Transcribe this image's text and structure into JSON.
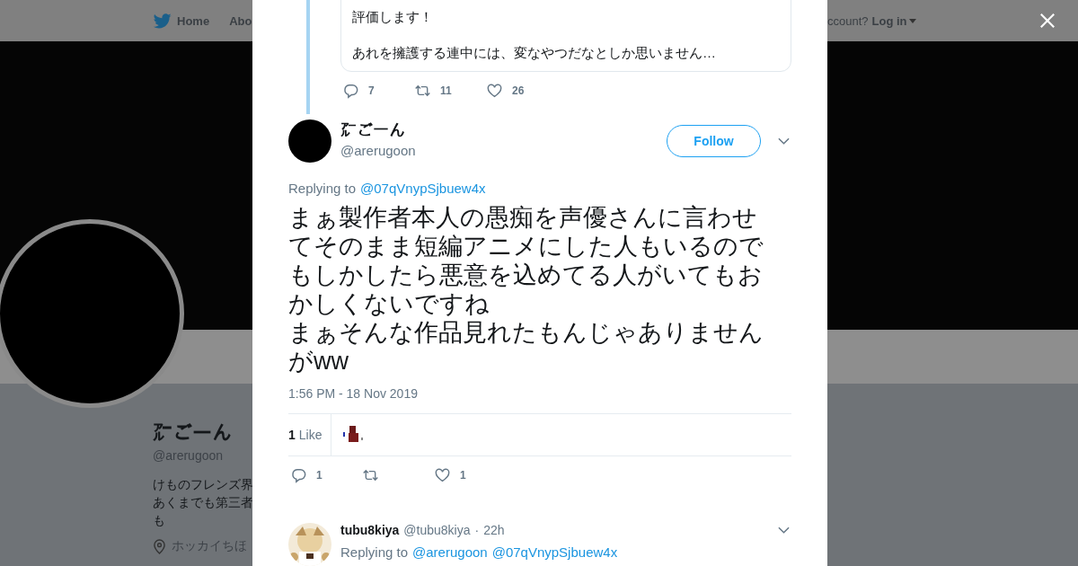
{
  "nav": {
    "items": [
      {
        "kind": "home",
        "label": "Home"
      },
      {
        "kind": "text",
        "label": "Abo"
      }
    ],
    "account_prompt": "ccount?",
    "login": "Log in"
  },
  "profile": {
    "name": "㌃ごーん",
    "handle": "@arerugoon",
    "bio_lines": [
      "けものフレンズ界",
      "あくまでも第三者",
      "も"
    ],
    "location": "ホッカイちほ"
  },
  "quoted": {
    "paragraphs": [
      "評価します！",
      "あれを擁護する連中には、変なやつだなとしか思いません…"
    ],
    "actions": [
      {
        "kind": "reply",
        "count": "7"
      },
      {
        "kind": "retweet",
        "count": "11"
      },
      {
        "kind": "like",
        "count": "26"
      }
    ]
  },
  "tweet": {
    "name": "㌃ごーん",
    "handle": "@arerugoon",
    "follow": "Follow",
    "replying_label": "Replying to",
    "replying_to": [
      "@07qVnypSjbuew4x"
    ],
    "text_paragraphs": [
      "まぁ製作者本人の愚痴を声優さんに言わせてそのまま短編アニメにした人もいるのでもしかしたら悪意を込めてる人がいてもおかしくないですね",
      "まぁそんな作品見れたもんじゃありませんがww"
    ],
    "time": "1:56 PM - 18 Nov 2019",
    "likes": {
      "count": "1",
      "label": "Like"
    },
    "actions": [
      {
        "kind": "reply",
        "count": "1"
      },
      {
        "kind": "retweet"
      },
      {
        "kind": "like",
        "count": "1"
      }
    ]
  },
  "replies": [
    {
      "name": "tubu8kiya",
      "handle": "@tubu8kiya",
      "separator": "·",
      "time": "22h",
      "replying_label": "Replying to",
      "replying_to": [
        "@arerugoon",
        "@07qVnypSjbuew4x"
      ]
    }
  ]
}
